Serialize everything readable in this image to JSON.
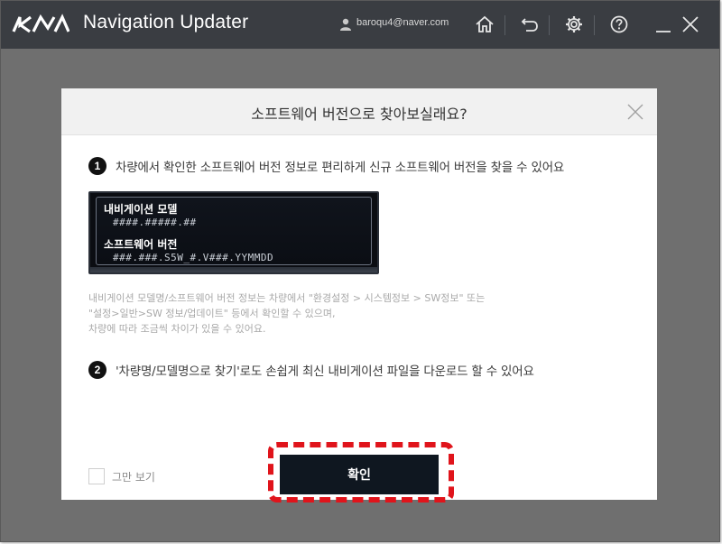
{
  "app": {
    "title": "Navigation Updater",
    "user_email": "baroqu4@naver.com"
  },
  "toolbar": {
    "icons": [
      "home-icon",
      "back-icon",
      "settings-icon",
      "help-icon",
      "minimize-icon",
      "close-icon"
    ]
  },
  "modal": {
    "title": "소프트웨어 버전으로 찾아보실래요?",
    "step1": {
      "number": "1",
      "text": "차량에서 확인한 소프트웨어 버전 정보로 편리하게 신규 소프트웨어 버전을 찾을 수 있어요"
    },
    "sample": {
      "model_label": "내비게이션 모델",
      "model_value": "####.#####.##",
      "version_label": "소프트웨어 버전",
      "version_value": "###.###.S5W_#.V###.YYMMDD"
    },
    "note": {
      "line1": "내비게이션 모델명/소프트웨어 버전 정보는 차량에서 \"환경설정 > 시스템정보 > SW정보\" 또는",
      "line2": "\"설정>일반>SW 정보/업데이트\" 등에서 확인할 수 있으며,",
      "line3": "차량에 따라 조금씩 차이가 있을 수 있어요."
    },
    "step2": {
      "number": "2",
      "text": "'차량명/모델명으로 찾기'로도 손쉽게 최신 내비게이션 파일을 다운로드 할 수 있어요"
    },
    "dont_show_label": "그만 보기",
    "confirm_label": "확인"
  },
  "colors": {
    "titlebar": "#3a3d42",
    "overlay": "#6f6f6f",
    "confirm_button": "#0f1720",
    "highlight": "#e0141b"
  }
}
